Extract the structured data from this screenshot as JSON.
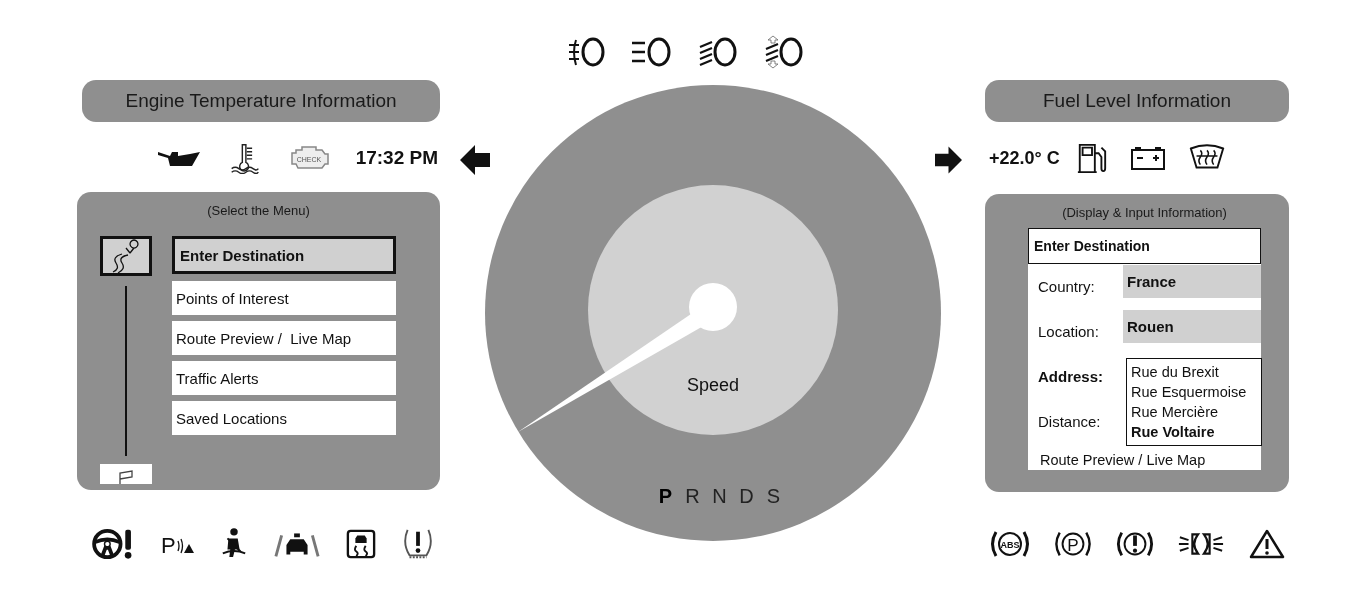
{
  "headlight_icons": [
    {
      "kind": "fog"
    },
    {
      "kind": "high"
    },
    {
      "kind": "low"
    },
    {
      "kind": "adaptive"
    }
  ],
  "left": {
    "title": "Engine Temperature Information",
    "indicators": [
      {
        "kind": "oil"
      },
      {
        "kind": "coolant"
      },
      {
        "kind": "check-engine",
        "label": "CHECK"
      }
    ],
    "time": "17:32 PM",
    "panel": {
      "caption": "(Select the Menu)",
      "menu": [
        {
          "label": "Enter Destination",
          "selected": true
        },
        {
          "label": "Points of Interest",
          "selected": false
        },
        {
          "label": "Route Preview /  Live Map",
          "selected": false
        },
        {
          "label": "Traffic Alerts",
          "selected": false
        },
        {
          "label": "Saved Locations",
          "selected": false
        }
      ]
    },
    "warning_icons": [
      {
        "kind": "steering"
      },
      {
        "kind": "park-assist",
        "label": "P"
      },
      {
        "kind": "seatbelt"
      },
      {
        "kind": "lane"
      },
      {
        "kind": "traction"
      },
      {
        "kind": "tire"
      }
    ]
  },
  "gauge": {
    "label": "Speed",
    "gears": [
      {
        "label": "P",
        "selected": true
      },
      {
        "label": "R",
        "selected": false
      },
      {
        "label": "N",
        "selected": false
      },
      {
        "label": "D",
        "selected": false
      },
      {
        "label": "S",
        "selected": false
      }
    ]
  },
  "right": {
    "title": "Fuel Level Information",
    "temperature": "+22.0° C",
    "indicators": [
      {
        "kind": "fuel"
      },
      {
        "kind": "battery"
      },
      {
        "kind": "defrost"
      }
    ],
    "panel": {
      "caption": "(Display & Input Information)",
      "header": "Enter Destination",
      "fields": [
        {
          "label": "Country:",
          "value": "France",
          "focused": false
        },
        {
          "label": "Location:",
          "value": "Rouen",
          "focused": false
        },
        {
          "label": "Address:",
          "focused": true,
          "options": [
            {
              "label": "Rue du Brexit",
              "selected": false
            },
            {
              "label": "Rue Esquermoise",
              "selected": false
            },
            {
              "label": "Rue Mercière",
              "selected": false
            },
            {
              "label": "Rue Voltaire",
              "selected": true
            }
          ]
        },
        {
          "label": "Distance:",
          "focused": false
        }
      ],
      "footer": "Route Preview / Live Map"
    },
    "warning_icons": [
      {
        "kind": "abs",
        "label": "ABS"
      },
      {
        "kind": "parking-brake",
        "label": "P"
      },
      {
        "kind": "brake"
      },
      {
        "kind": "lights"
      },
      {
        "kind": "hazard"
      }
    ]
  }
}
